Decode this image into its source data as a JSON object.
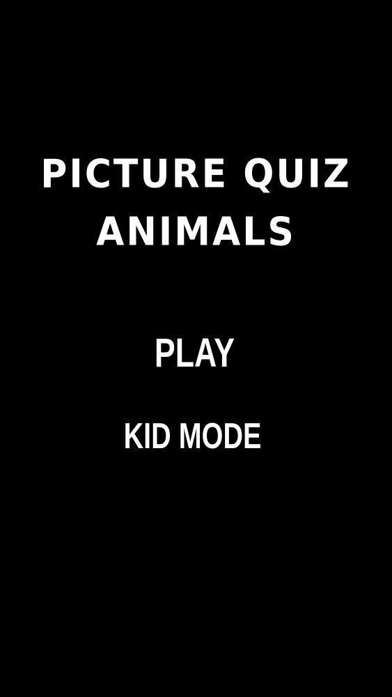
{
  "title": {
    "line1": "PICTURE QUIZ",
    "line2": "ANIMALS"
  },
  "menu": {
    "play_label": "PLAY",
    "kid_mode_label": "KID MODE"
  },
  "colors": {
    "background": "#000000",
    "text": "#ffffff"
  }
}
